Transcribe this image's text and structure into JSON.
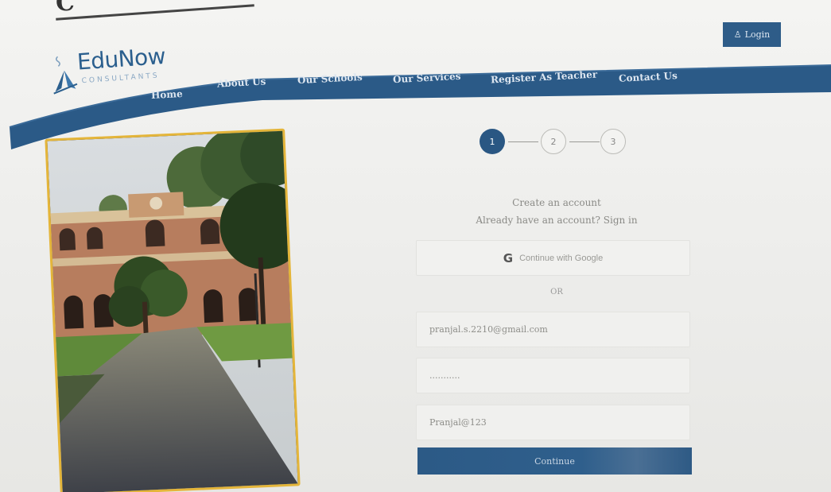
{
  "brand": {
    "name": "EduNow",
    "tagline": "CONSULTANTS"
  },
  "header": {
    "login_label": "Login"
  },
  "nav": {
    "items": [
      {
        "label": "Home"
      },
      {
        "label": "About Us"
      },
      {
        "label": "Our Schools"
      },
      {
        "label": "Our Services"
      },
      {
        "label": "Register As Teacher"
      },
      {
        "label": "Contact Us"
      }
    ]
  },
  "stepper": {
    "steps": [
      "1",
      "2",
      "3"
    ],
    "current": 1
  },
  "form": {
    "title": "Create an account",
    "subtitle": "Already have an account? Sign in",
    "google_label": "Continue with Google",
    "or_label": "OR",
    "email_value": "pranjal.s.2210@gmail.com",
    "password_value": "...........",
    "confirm_value": "Pranjal@123",
    "continue_label": "Continue"
  },
  "colors": {
    "brand_blue": "#2b5f8e",
    "nav_blue": "#2e5c88",
    "frame_gold": "#e4b53a"
  }
}
